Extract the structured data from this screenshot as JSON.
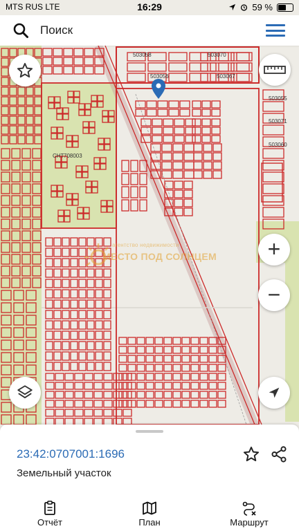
{
  "status_bar": {
    "carrier": "MTS RUS  LTE",
    "time": "16:29",
    "battery": "59 %",
    "battery_level": 0.59
  },
  "search": {
    "placeholder": "Поиск"
  },
  "map": {
    "labels": [
      "503058",
      "503070",
      "503056",
      "503067",
      "503055",
      "503071",
      "503060",
      "708003",
      "СНТ"
    ],
    "watermark_top": "агентство недвижимости",
    "watermark_main": "МЕСТО ПОД СОЛНЦЕМ",
    "colors": {
      "parcel": "#cc2a2a",
      "background": "#eeece6",
      "green": "#d9e3b0",
      "road": "#f6f4ef",
      "accent": "#2b6bb5"
    }
  },
  "controls": {
    "zoom_in": "+",
    "zoom_out": "−"
  },
  "panel": {
    "cadastral_number": "23:42:0707001:1696",
    "object_type": "Земельный участок"
  },
  "tabs": [
    {
      "label": "Отчёт",
      "icon": "report-icon"
    },
    {
      "label": "План",
      "icon": "map-plan-icon"
    },
    {
      "label": "Маршрут",
      "icon": "route-icon"
    }
  ]
}
